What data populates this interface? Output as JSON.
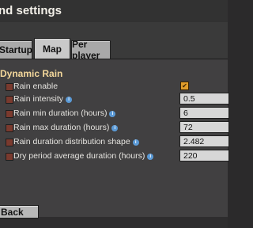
{
  "window": {
    "title": "nd settings"
  },
  "tabs": [
    {
      "label": "Startup"
    },
    {
      "label": "Map"
    },
    {
      "label": "Per player"
    }
  ],
  "active_tab": "Map",
  "group": {
    "title": "Dynamic Rain"
  },
  "settings": [
    {
      "label": "Rain enable",
      "type": "checkbox",
      "checked": true,
      "checkmark": "✔"
    },
    {
      "label": "Rain intensity",
      "type": "text",
      "value": "0.5"
    },
    {
      "label": "Rain min duration (hours)",
      "type": "text",
      "value": "6"
    },
    {
      "label": "Rain max duration (hours)",
      "type": "text",
      "value": "72"
    },
    {
      "label": "Rain duration distribution shape",
      "type": "text",
      "value": "2.482"
    },
    {
      "label": "Dry period average duration (hours)",
      "type": "text",
      "value": "220"
    }
  ],
  "info_glyph": "i",
  "footer": {
    "back_label": "Back"
  },
  "colors": {
    "accent_heading": "#f3d79b",
    "checkbox": "#e09d2b",
    "info_icon": "#5b9ad6",
    "bullet": "#7a3a2e"
  }
}
